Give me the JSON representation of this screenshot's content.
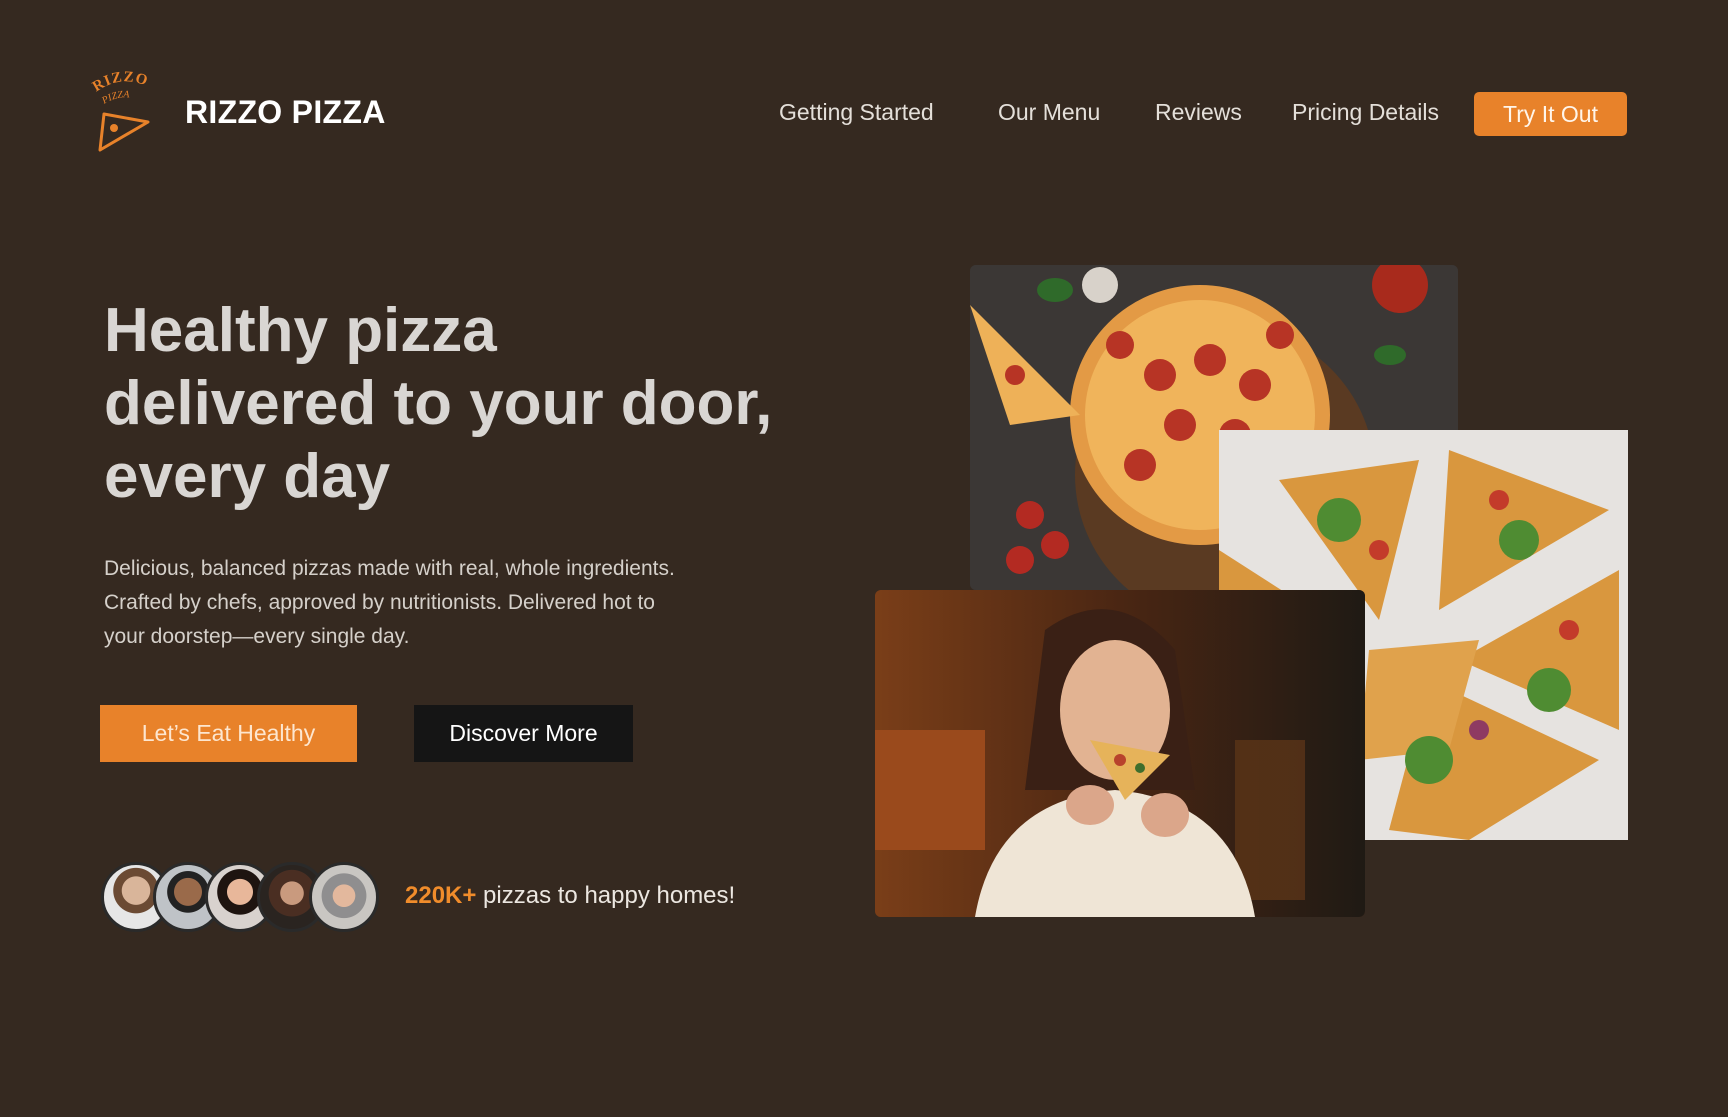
{
  "brand": {
    "name": "RIZZO PIZZA",
    "logo_text_top": "RIZZO",
    "logo_text_bottom": "PIZZA",
    "logo_icon": "pizza-slice-icon",
    "accent_color": "#e8822a"
  },
  "nav": {
    "items": [
      {
        "label": "Getting Started"
      },
      {
        "label": "Our Menu"
      },
      {
        "label": "Reviews"
      },
      {
        "label": "Pricing Details"
      }
    ],
    "cta_label": "Try It Out"
  },
  "hero": {
    "headline_lines": [
      "Healthy pizza",
      "delivered to your door,",
      "every day"
    ],
    "subtext_lines": [
      "Delicious, balanced pizzas made with real, whole ingredients.",
      "Crafted by chefs, approved by nutritionists. Delivered hot to",
      "your doorstep—every single day."
    ],
    "primary_cta": "Let’s Eat Healthy",
    "secondary_cta": "Discover More"
  },
  "social_proof": {
    "highlight": "220K+",
    "text": " pizzas to happy homes!",
    "avatar_count": 5
  },
  "images": [
    {
      "name": "pepperoni-pizza-photo"
    },
    {
      "name": "veggie-pizza-photo"
    },
    {
      "name": "woman-eating-pizza-photo"
    }
  ],
  "colors": {
    "background": "#352920",
    "accent": "#e8822a",
    "dark_button": "#151515"
  }
}
